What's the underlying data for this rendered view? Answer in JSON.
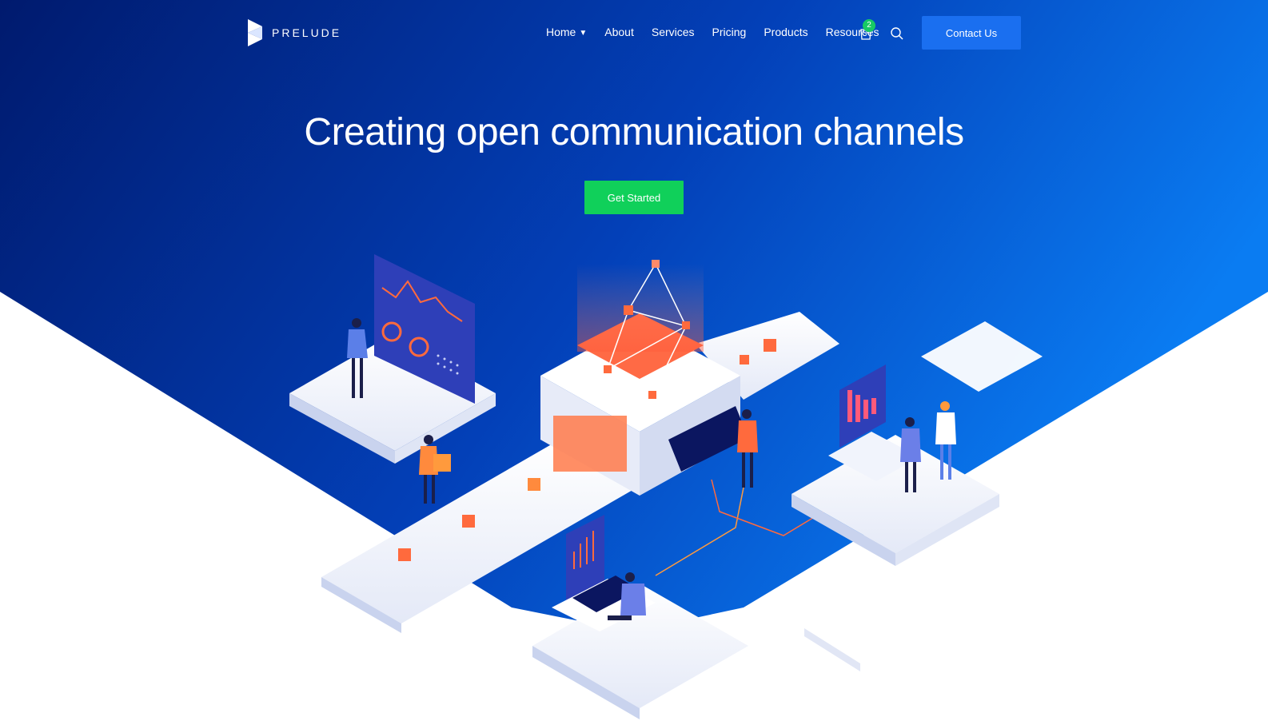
{
  "brand": {
    "name": "PRELUDE",
    "logo_icon": "prism-logo-icon"
  },
  "nav": {
    "items": [
      {
        "label": "Home",
        "has_dropdown": true
      },
      {
        "label": "About"
      },
      {
        "label": "Services"
      },
      {
        "label": "Pricing"
      },
      {
        "label": "Products"
      },
      {
        "label": "Resources"
      }
    ],
    "cart_count": "2",
    "cart_icon": "shopping-bag-icon",
    "search_icon": "search-icon",
    "contact_label": "Contact Us"
  },
  "hero": {
    "title": "Creating open communication channels",
    "cta_label": "Get Started"
  },
  "colors": {
    "hero_gradient_start": "#001a6e",
    "hero_gradient_end": "#0a7cf2",
    "accent_green": "#10d05a",
    "contact_blue": "#1a6ff0",
    "badge_green": "#17c964",
    "orange": "#ff6a3d"
  }
}
